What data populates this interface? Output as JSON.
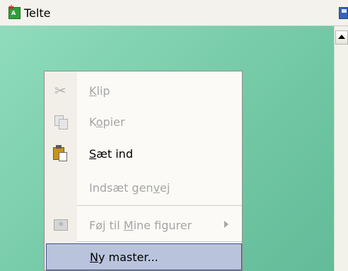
{
  "window": {
    "title": "Telte",
    "app_icon": "app-shape-icon",
    "save_icon": "save-icon"
  },
  "canvas": {
    "background_color": "#7fd1b0"
  },
  "context_menu": {
    "items": [
      {
        "label_pre": "",
        "mnemonic": "K",
        "label_post": "lip",
        "enabled": false,
        "icon": "scissors-icon"
      },
      {
        "label_pre": "K",
        "mnemonic": "o",
        "label_post": "pier",
        "enabled": false,
        "icon": "copy-icon"
      },
      {
        "label_pre": "",
        "mnemonic": "S",
        "label_post": "æt ind",
        "enabled": true,
        "icon": "paste-icon"
      },
      {
        "label_pre": "Indsæt gen",
        "mnemonic": "v",
        "label_post": "ej",
        "enabled": false,
        "icon": ""
      },
      {
        "label_pre": "Føj til ",
        "mnemonic": "M",
        "label_post": "ine figurer",
        "enabled": false,
        "icon": "shapes-folder-icon",
        "has_submenu": true
      },
      {
        "label_pre": "",
        "mnemonic": "N",
        "label_post": "y master...",
        "enabled": true,
        "highlighted": true,
        "icon": ""
      }
    ]
  },
  "colors": {
    "menu_highlight": "#b9c4dc",
    "menu_highlight_border": "#3c5285",
    "disabled_text": "#a5a5a5"
  }
}
